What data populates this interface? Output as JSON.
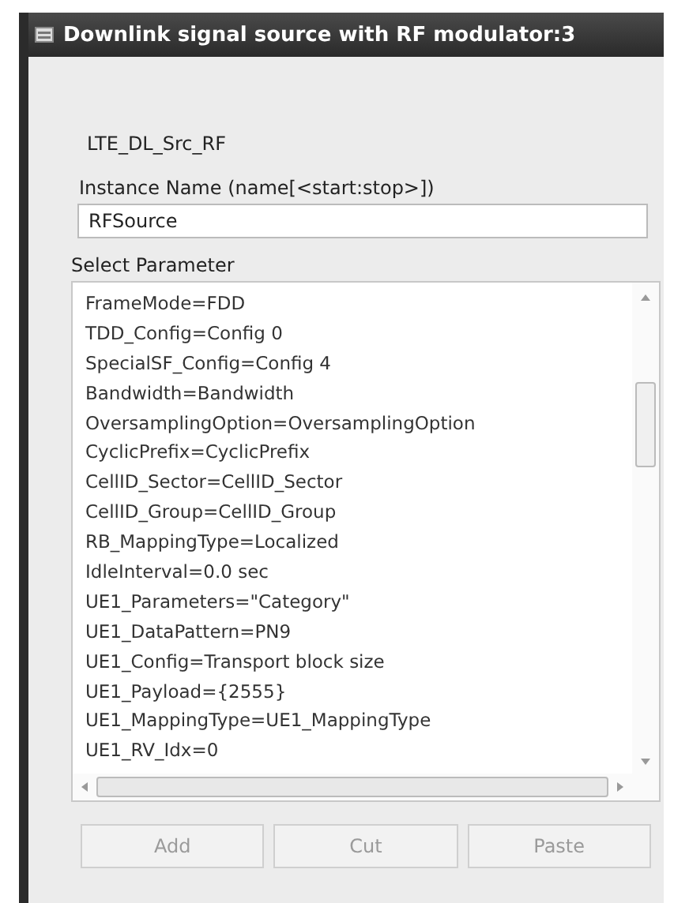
{
  "window": {
    "title": "Downlink signal source with RF modulator:3"
  },
  "component_name": "LTE_DL_Src_RF",
  "instance_name": {
    "label": "Instance Name  (name[<start:stop>])",
    "value": "RFSource"
  },
  "parameters": {
    "label": "Select Parameter",
    "items": [
      "FrameMode=FDD",
      "TDD_Config=Config 0",
      "SpecialSF_Config=Config 4",
      "Bandwidth=Bandwidth",
      "OversamplingOption=OversamplingOption",
      "CyclicPrefix=CyclicPrefix",
      "CellID_Sector=CellID_Sector",
      "CellID_Group=CellID_Group",
      "RB_MappingType=Localized",
      "IdleInterval=0.0 sec",
      "UE1_Parameters=\"Category\"",
      "UE1_DataPattern=PN9",
      "UE1_Config=Transport block size",
      "UE1_Payload={2555}",
      "UE1_MappingType=UE1_MappingType",
      "UE1_RV_Idx=0"
    ]
  },
  "buttons": [
    {
      "label": "Add",
      "disabled": true
    },
    {
      "label": "Cut",
      "disabled": true
    },
    {
      "label": "Paste",
      "disabled": true
    }
  ]
}
